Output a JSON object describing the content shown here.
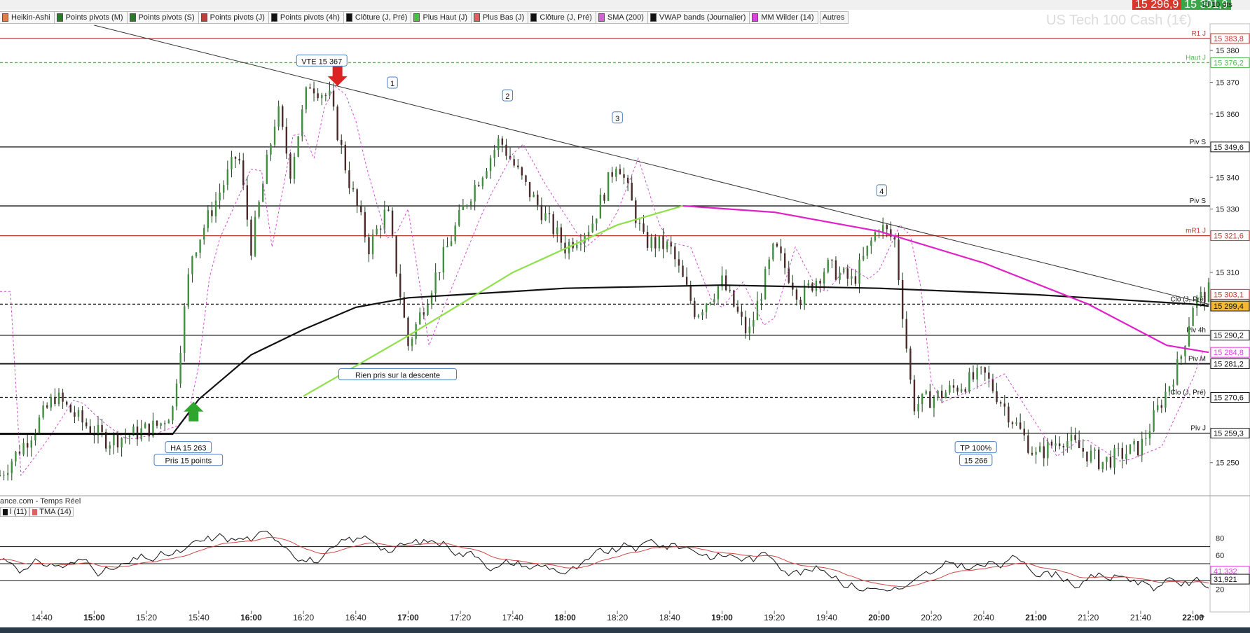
{
  "app": {
    "symbol_title": "US Tech 100 Cash (1€)",
    "source_label": "ance.com - Temps Réel",
    "pts_value": "10",
    "pts_unit": "pts",
    "bid_price": "15 2̲96,9",
    "ask_price": "15 301,9",
    "bid_color": "#d9362c",
    "ask_color": "#3aa64a"
  },
  "tabs": [
    {
      "label": "Heikin-Ashi",
      "color": "#e07b4a"
    },
    {
      "label": "Points pivots (M)",
      "color": "#2a7a2a"
    },
    {
      "label": "Points pivots (S)",
      "color": "#2a7a2a"
    },
    {
      "label": "Points pivots (J)",
      "color": "#c23b3b"
    },
    {
      "label": "Points pivots (4h)",
      "color": "#111111"
    },
    {
      "label": "Clôture (J, Pré)",
      "color": "#111111"
    },
    {
      "label": "Plus Haut (J)",
      "color": "#48c048"
    },
    {
      "label": "Plus Bas (J)",
      "color": "#e06060"
    },
    {
      "label": "Clôture (J, Pré)",
      "color": "#111111"
    },
    {
      "label": "SMA (200)",
      "color": "#cc66cc"
    },
    {
      "label": "VWAP bands (Journalier)",
      "color": "#111111"
    },
    {
      "label": "MM Wilder (14)",
      "color": "#e040e0"
    },
    {
      "label": "Autres",
      "color": ""
    }
  ],
  "oscillator_tabs": [
    {
      "label": "l (11)",
      "color": "#111111"
    },
    {
      "label": "TMA (14)",
      "color": "#e06060"
    }
  ],
  "chart_data": {
    "type": "candlestick",
    "y_range": [
      15240,
      15388
    ],
    "x_range": [
      "14:24",
      "22:06"
    ],
    "y_ticks": [
      15380,
      15370,
      15360,
      15340,
      15330,
      15310,
      15250
    ],
    "x_ticks": [
      "14:40",
      "15:00",
      "15:20",
      "15:40",
      "16:00",
      "16:20",
      "16:40",
      "17:00",
      "17:20",
      "17:40",
      "18:00",
      "18:20",
      "18:40",
      "19:00",
      "19:20",
      "19:40",
      "20:00",
      "20:20",
      "20:40",
      "21:00",
      "21:20",
      "21:40",
      "22:00"
    ],
    "x_ticks_bold": [
      "15:00",
      "16:00",
      "17:00",
      "18:00",
      "19:00",
      "20:00",
      "21:00",
      "22:00"
    ],
    "levels": [
      {
        "name": "R1 J",
        "value": 15383.8,
        "label": "15 383,8",
        "color": "#c0392b",
        "style": "solid"
      },
      {
        "name": "Haut J",
        "value": 15376.2,
        "label": "15 376,2",
        "color": "#4cbf4c",
        "style": "dashed"
      },
      {
        "name": "Piv S",
        "value": 15349.6,
        "label": "15 349,6",
        "color": "#111111",
        "style": "solid"
      },
      {
        "name": "Piv S",
        "value": 15331.0,
        "label": "",
        "color": "#111111",
        "style": "solid"
      },
      {
        "name": "mR1 J",
        "value": 15321.6,
        "label": "15 321,6",
        "color": "#c0392b",
        "style": "solid"
      },
      {
        "name": "Clo (J, Pré)",
        "value": 15300.0,
        "label": "15 300,0",
        "color": "#111111",
        "style": "dashed"
      },
      {
        "name": "Piv 4h",
        "value": 15290.2,
        "label": "15 290,2",
        "color": "#111111",
        "style": "solid"
      },
      {
        "name": "Piv M",
        "value": 15281.2,
        "label": "15 281,2",
        "color": "#111111",
        "style": "solid"
      },
      {
        "name": "Clo (J, Pré)",
        "value": 15270.6,
        "label": "15 270,6",
        "color": "#111111",
        "style": "dashed"
      },
      {
        "name": "Piv J",
        "value": 15259.3,
        "label": "15 259,3",
        "color": "#111111",
        "style": "solid"
      }
    ],
    "extra_axis_labels": [
      {
        "label": "15 303,1",
        "value": 15303.1,
        "bg": "#ffffff",
        "fg": "#c0392b"
      },
      {
        "label": "15 299,4",
        "value": 15299.4,
        "bg": "#f5b833",
        "fg": "#111111"
      },
      {
        "label": "15 284,8",
        "value": 15284.8,
        "bg": "#ffffff",
        "fg": "#e040e0"
      },
      {
        "label": "15 270,6",
        "value": 15270.6,
        "bg": "#ffffff",
        "fg": "#111111"
      }
    ],
    "annotations": [
      {
        "text": "VTE 15 367",
        "time": "16:27",
        "value": 15376
      },
      {
        "text": "1",
        "time": "16:54",
        "value": 15369
      },
      {
        "text": "2",
        "time": "17:38",
        "value": 15365
      },
      {
        "text": "3",
        "time": "18:20",
        "value": 15358
      },
      {
        "text": "4",
        "time": "20:01",
        "value": 15335
      },
      {
        "text": "Rien pris sur la descente",
        "time": "16:56",
        "value": 15277
      },
      {
        "text": "HA 15 263",
        "time": "15:36",
        "value": 15254
      },
      {
        "text": "Pris 15 points",
        "time": "15:36",
        "value": 15250
      },
      {
        "text": "TP  100%",
        "time": "20:37",
        "value": 15254
      },
      {
        "text": "15 266",
        "time": "20:37",
        "value": 15250
      }
    ],
    "series_price_key": [
      {
        "time": "14:24",
        "value": 15246
      },
      {
        "time": "14:35",
        "value": 15258
      },
      {
        "time": "14:45",
        "value": 15271
      },
      {
        "time": "14:55",
        "value": 15263
      },
      {
        "time": "15:05",
        "value": 15257
      },
      {
        "time": "15:15",
        "value": 15259
      },
      {
        "time": "15:25",
        "value": 15262
      },
      {
        "time": "15:30",
        "value": 15267
      },
      {
        "time": "15:37",
        "value": 15315
      },
      {
        "time": "15:45",
        "value": 15330
      },
      {
        "time": "15:55",
        "value": 15348
      },
      {
        "time": "16:00",
        "value": 15318
      },
      {
        "time": "16:10",
        "value": 15362
      },
      {
        "time": "16:15",
        "value": 15342
      },
      {
        "time": "16:22",
        "value": 15370
      },
      {
        "time": "16:30",
        "value": 15365
      },
      {
        "time": "16:37",
        "value": 15340
      },
      {
        "time": "16:45",
        "value": 15318
      },
      {
        "time": "16:52",
        "value": 15330
      },
      {
        "time": "17:00",
        "value": 15287
      },
      {
        "time": "17:10",
        "value": 15308
      },
      {
        "time": "17:22",
        "value": 15332
      },
      {
        "time": "17:35",
        "value": 15352
      },
      {
        "time": "17:45",
        "value": 15337
      },
      {
        "time": "18:00",
        "value": 15318
      },
      {
        "time": "18:10",
        "value": 15325
      },
      {
        "time": "18:20",
        "value": 15346
      },
      {
        "time": "18:30",
        "value": 15320
      },
      {
        "time": "18:40",
        "value": 15318
      },
      {
        "time": "18:50",
        "value": 15297
      },
      {
        "time": "19:00",
        "value": 15307
      },
      {
        "time": "19:10",
        "value": 15290
      },
      {
        "time": "19:20",
        "value": 15318
      },
      {
        "time": "19:30",
        "value": 15302
      },
      {
        "time": "19:40",
        "value": 15312
      },
      {
        "time": "19:50",
        "value": 15307
      },
      {
        "time": "20:00",
        "value": 15325
      },
      {
        "time": "20:06",
        "value": 15320
      },
      {
        "time": "20:13",
        "value": 15268
      },
      {
        "time": "20:25",
        "value": 15272
      },
      {
        "time": "20:40",
        "value": 15278
      },
      {
        "time": "20:50",
        "value": 15265
      },
      {
        "time": "21:00",
        "value": 15252
      },
      {
        "time": "21:10",
        "value": 15258
      },
      {
        "time": "21:25",
        "value": 15250
      },
      {
        "time": "21:40",
        "value": 15255
      },
      {
        "time": "21:55",
        "value": 15282
      },
      {
        "time": "22:00",
        "value": 15300
      },
      {
        "time": "22:06",
        "value": 15304
      }
    ],
    "vwap": [
      {
        "time": "14:24",
        "value": 15259
      },
      {
        "time": "15:30",
        "value": 15259
      },
      {
        "time": "15:40",
        "value": 15270
      },
      {
        "time": "16:00",
        "value": 15284
      },
      {
        "time": "16:20",
        "value": 15292
      },
      {
        "time": "16:40",
        "value": 15299
      },
      {
        "time": "17:00",
        "value": 15302
      },
      {
        "time": "18:00",
        "value": 15305
      },
      {
        "time": "19:00",
        "value": 15306
      },
      {
        "time": "20:00",
        "value": 15305
      },
      {
        "time": "21:00",
        "value": 15303
      },
      {
        "time": "22:00",
        "value": 15300
      },
      {
        "time": "22:06",
        "value": 15299.4
      }
    ],
    "sma200": [
      {
        "time": "16:20",
        "value": 15271
      },
      {
        "time": "17:00",
        "value": 15290
      },
      {
        "time": "17:40",
        "value": 15310
      },
      {
        "time": "18:20",
        "value": 15325
      },
      {
        "time": "18:45",
        "value": 15331
      }
    ],
    "wilder": [
      {
        "time": "18:45",
        "value": 15331
      },
      {
        "time": "19:20",
        "value": 15329
      },
      {
        "time": "20:00",
        "value": 15323
      },
      {
        "time": "20:40",
        "value": 15313
      },
      {
        "time": "21:20",
        "value": 15300
      },
      {
        "time": "21:50",
        "value": 15287
      },
      {
        "time": "22:06",
        "value": 15284.8
      }
    ],
    "trendline": [
      {
        "time": "15:00",
        "value": 15388
      },
      {
        "time": "22:06",
        "value": 15300
      }
    ],
    "oscillator": {
      "y_range": [
        0,
        100
      ],
      "ticks": [
        "80",
        "60",
        "20"
      ],
      "labels": [
        {
          "label": "41,332",
          "value": 41.3,
          "fg": "#e040e0"
        },
        {
          "label": "31,921",
          "value": 31.9,
          "fg": "#111111"
        }
      ],
      "levels": [
        70,
        50,
        30
      ]
    }
  }
}
